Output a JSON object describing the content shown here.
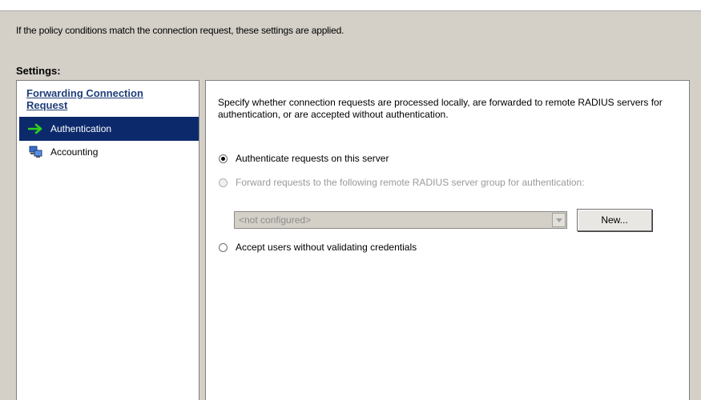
{
  "intro_text": "If the policy conditions match the connection request, these settings are applied.",
  "settings_label": "Settings:",
  "left_panel": {
    "heading": "Forwarding Connection Request",
    "items": [
      {
        "label": "Authentication",
        "icon": "green-arrow-icon",
        "selected": true
      },
      {
        "label": "Accounting",
        "icon": "network-computers-icon",
        "selected": false
      }
    ]
  },
  "right_panel": {
    "description": "Specify whether connection requests are processed locally, are forwarded to remote RADIUS servers for authentication, or are accepted without authentication.",
    "options": [
      {
        "label": "Authenticate requests on this server",
        "checked": true,
        "enabled": true
      },
      {
        "label": "Forward requests to the following remote RADIUS server group for authentication:",
        "checked": false,
        "enabled": false
      },
      {
        "label": "Accept users without validating credentials",
        "checked": false,
        "enabled": true
      }
    ],
    "server_group_combo": {
      "value": "<not configured>",
      "enabled": false
    },
    "new_button": "New..."
  },
  "colors": {
    "selection": "#0c2a6b",
    "heading": "#1f3e7a",
    "window_bg": "#d4d0c8"
  }
}
